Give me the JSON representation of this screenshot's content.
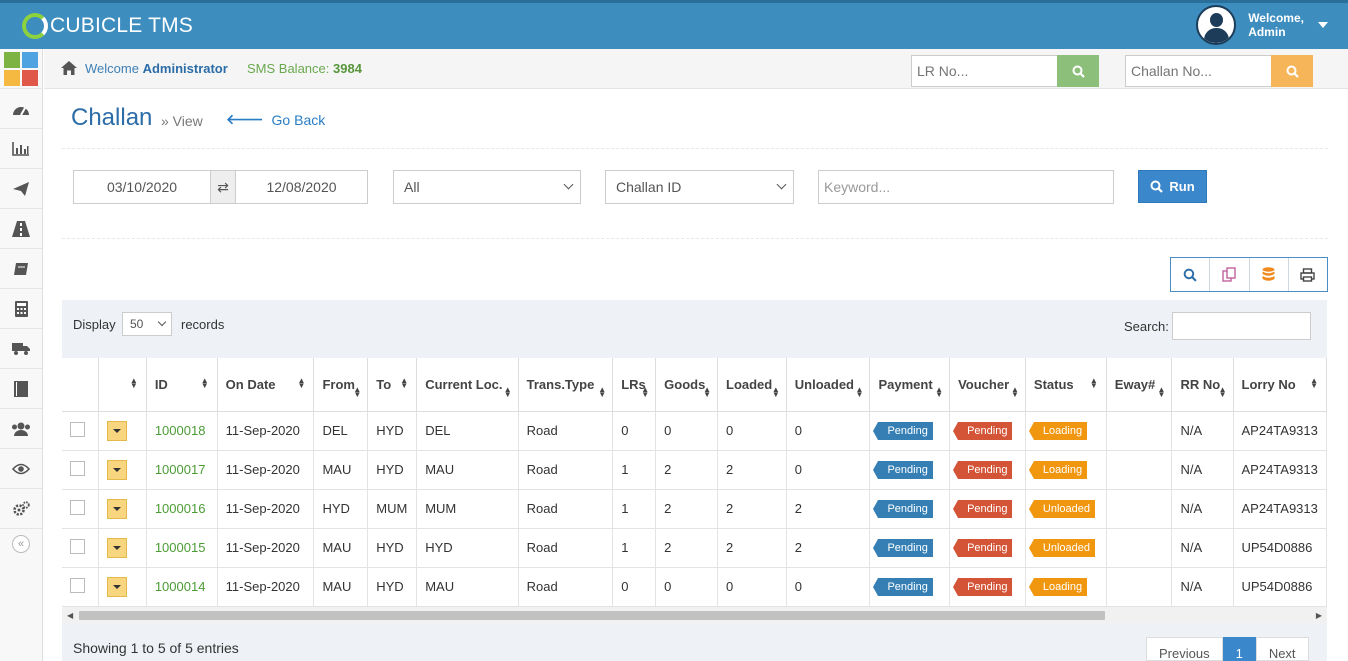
{
  "app": {
    "name": "CUBICLE TMS"
  },
  "user": {
    "welcome": "Welcome,",
    "name": "Admin"
  },
  "breadcrumb": {
    "welcome_prefix": "Welcome",
    "welcome_name": "Administrator",
    "sms_label": "SMS Balance:",
    "sms_value": "3984"
  },
  "quick_search": {
    "lr_placeholder": "LR No...",
    "challan_placeholder": "Challan No..."
  },
  "page": {
    "title": "Challan",
    "subtitle": "» View",
    "go_back": "Go Back"
  },
  "filters": {
    "date_from": "03/10/2020",
    "swap_icon": "⇄",
    "date_to": "12/08/2020",
    "status_select": "All",
    "field_select": "Challan ID",
    "keyword_placeholder": "Keyword...",
    "run_label": "Run"
  },
  "table_controls": {
    "display_label": "Display",
    "display_value": "50",
    "records_label": "records",
    "search_label": "Search:"
  },
  "columns": [
    "ID",
    "On Date",
    "From",
    "To",
    "Current Loc.",
    "Trans.Type",
    "LRs",
    "Goods",
    "Loaded",
    "Unloaded",
    "Payment",
    "Voucher",
    "Status",
    "Eway#",
    "RR No",
    "Lorry No"
  ],
  "rows": [
    {
      "id": "1000018",
      "date": "11-Sep-2020",
      "from": "DEL",
      "to": "HYD",
      "loc": "DEL",
      "type": "Road",
      "lrs": "0",
      "goods": "0",
      "loaded": "0",
      "unloaded": "0",
      "payment": "Pending",
      "voucher": "Pending",
      "status": "Loading",
      "eway": "",
      "rr": "N/A",
      "lorry": "AP24TA9313"
    },
    {
      "id": "1000017",
      "date": "11-Sep-2020",
      "from": "MAU",
      "to": "HYD",
      "loc": "MAU",
      "type": "Road",
      "lrs": "1",
      "goods": "2",
      "loaded": "2",
      "unloaded": "0",
      "payment": "Pending",
      "voucher": "Pending",
      "status": "Loading",
      "eway": "",
      "rr": "N/A",
      "lorry": "AP24TA9313"
    },
    {
      "id": "1000016",
      "date": "11-Sep-2020",
      "from": "HYD",
      "to": "MUM",
      "loc": "MUM",
      "type": "Road",
      "lrs": "1",
      "goods": "2",
      "loaded": "2",
      "unloaded": "2",
      "payment": "Pending",
      "voucher": "Pending",
      "status": "Unloaded",
      "eway": "",
      "rr": "N/A",
      "lorry": "AP24TA9313"
    },
    {
      "id": "1000015",
      "date": "11-Sep-2020",
      "from": "MAU",
      "to": "HYD",
      "loc": "HYD",
      "type": "Road",
      "lrs": "1",
      "goods": "2",
      "loaded": "2",
      "unloaded": "2",
      "payment": "Pending",
      "voucher": "Pending",
      "status": "Unloaded",
      "eway": "",
      "rr": "N/A",
      "lorry": "UP54D0886"
    },
    {
      "id": "1000014",
      "date": "11-Sep-2020",
      "from": "MAU",
      "to": "HYD",
      "loc": "MAU",
      "type": "Road",
      "lrs": "0",
      "goods": "0",
      "loaded": "0",
      "unloaded": "0",
      "payment": "Pending",
      "voucher": "Pending",
      "status": "Loading",
      "eway": "",
      "rr": "N/A",
      "lorry": "UP54D0886"
    }
  ],
  "footer": {
    "showing": "Showing 1 to 5 of 5 entries",
    "previous": "Previous",
    "page": "1",
    "next": "Next"
  },
  "sidebar_icons": [
    "dashboard-icon",
    "bar-chart-icon",
    "paper-plane-icon",
    "road-icon",
    "book-icon",
    "calculator-icon",
    "truck-icon",
    "ledger-icon",
    "users-icon",
    "eye-icon",
    "cogs-icon"
  ],
  "colors": {
    "header": "#3d8dbf",
    "accent": "#3a87cc",
    "pending_blue": "#357fb5",
    "pending_red": "#d45438",
    "status_orange": "#f0960f"
  }
}
